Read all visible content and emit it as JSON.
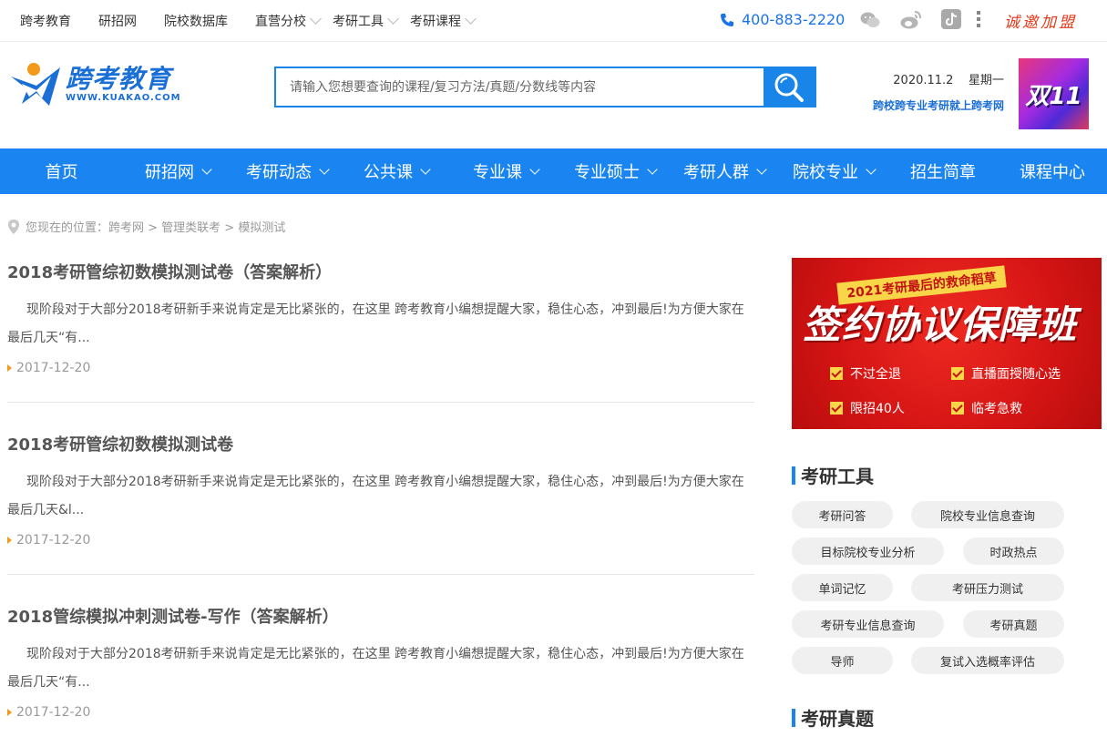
{
  "topnav": {
    "items": [
      "跨考教育",
      "研招网",
      "院校数据库"
    ],
    "dropdowns": [
      "直营分校",
      "考研工具",
      "考研课程"
    ]
  },
  "phone": "400-883-2220",
  "join_text": "诚邀加盟",
  "logo": {
    "main": "跨考教育",
    "url": "WWW.KUAKAO.COM"
  },
  "search": {
    "placeholder": "请输入您想要查询的课程/复习方法/真题/分数线等内容"
  },
  "date": {
    "date": "2020.11.2",
    "weekday": "星期一",
    "slogan": "跨校跨专业考研就上跨考网"
  },
  "promo_small": "双11",
  "mainnav": [
    {
      "label": "首页",
      "dropdown": false
    },
    {
      "label": "研招网",
      "dropdown": true
    },
    {
      "label": "考研动态",
      "dropdown": true
    },
    {
      "label": "公共课",
      "dropdown": true
    },
    {
      "label": "专业课",
      "dropdown": true
    },
    {
      "label": "专业硕士",
      "dropdown": true
    },
    {
      "label": "考研人群",
      "dropdown": true
    },
    {
      "label": "院校专业",
      "dropdown": true
    },
    {
      "label": "招生简章",
      "dropdown": false
    },
    {
      "label": "课程中心",
      "dropdown": false
    }
  ],
  "breadcrumb": "您现在的位置：跨考网 > 管理类联考 > 模拟测试",
  "articles": [
    {
      "title": "2018考研管综初数模拟测试卷（答案解析）",
      "summary": "现阶段对于大部分2018考研新手来说肯定是无比紧张的，在这里 跨考教育小编想提醒大家，稳住心态，冲到最后!为方便大家在最后几天“有...",
      "date": "2017-12-20"
    },
    {
      "title": "2018考研管综初数模拟测试卷",
      "summary": " 现阶段对于大部分2018考研新手来说肯定是无比紧张的，在这里 跨考教育小编想提醒大家，稳住心态，冲到最后!为方便大家在最后几天&l...",
      "date": "2017-12-20"
    },
    {
      "title": "2018管综模拟冲刺测试卷-写作（答案解析）",
      "summary": "现阶段对于大部分2018考研新手来说肯定是无比紧张的，在这里 跨考教育小编想提醒大家，稳住心态，冲到最后!为方便大家在最后几天“有...",
      "date": "2017-12-20"
    }
  ],
  "banner": {
    "tag": "2021考研最后的救命稻草",
    "headline": "签约协议保障班",
    "features": [
      "不过全退",
      "直播面授随心选",
      "限招40人",
      "临考急救"
    ]
  },
  "tools": {
    "title": "考研工具",
    "items": [
      "考研问答",
      "院校专业信息查询",
      "目标院校专业分析",
      "时政热点",
      "单词记忆",
      "考研压力测试",
      "考研专业信息查询",
      "考研真题",
      "导师",
      "复试入选概率评估"
    ]
  },
  "zhenti": {
    "title": "考研真题"
  },
  "colors": {
    "brand_blue": "#1a85f0",
    "accent_orange": "#f39a1a",
    "join_red": "#e33a1a"
  }
}
